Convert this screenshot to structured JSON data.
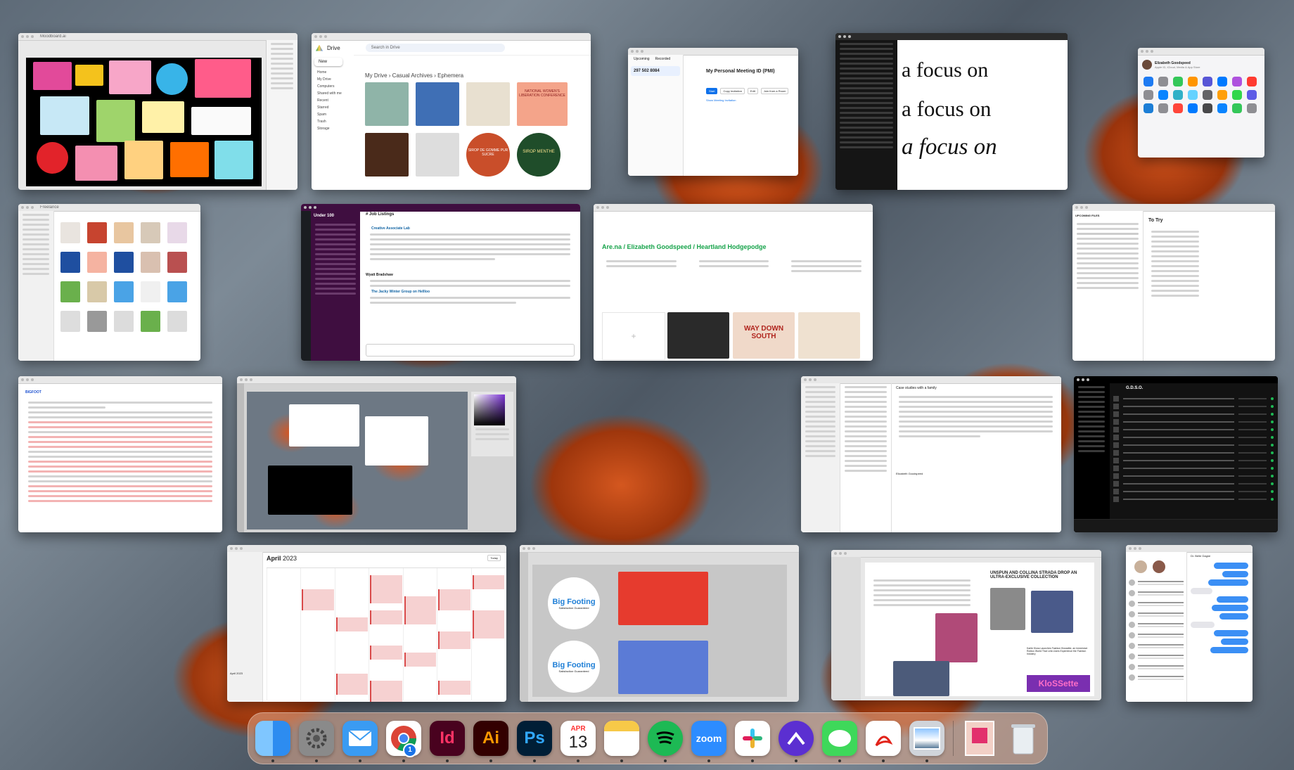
{
  "windows": {
    "illustrator_moodboard": {
      "title": "Moodboard.ai"
    },
    "drive": {
      "app": "Drive",
      "search_placeholder": "Search in Drive",
      "breadcrumb": [
        "My Drive",
        "Casual Archives",
        "Ephemera"
      ],
      "new_label": "New",
      "sidebar": [
        "Home",
        "My Drive",
        "Computers",
        "Shared with me",
        "Recent",
        "Starred",
        "Spam",
        "Trash",
        "Storage"
      ],
      "card_texts": [
        "NATIONAL WOMEN'S LIBERATION CONFERENCE",
        "SIROP DE GOMME PUR SUCRE",
        "SIROP MENTHE"
      ]
    },
    "zoom": {
      "tabs": [
        "Upcoming",
        "Recorded"
      ],
      "meeting_id": "297 502 8084",
      "meeting_title": "My Personal Meeting ID (PMI)",
      "buttons": [
        "Start",
        "Copy Invitation",
        "Edit",
        "Join from a Room"
      ],
      "link": "Show Meeting Invitation"
    },
    "type_preview": {
      "lines": [
        "a focus on",
        "a focus on",
        "a focus on"
      ]
    },
    "system_settings": {
      "user": "Elizabeth Goodspeed",
      "subtitle": "Apple ID, iCloud, Media & App Store"
    },
    "finder": {
      "title": "Freelance"
    },
    "slack": {
      "workspace": "Under 100",
      "channel": "# Job Listings",
      "post_title": "Creative Associate Lab",
      "post_title2": "The Jacky Winter Group on Hellloo",
      "post_author": "Wyatt Bradshaw"
    },
    "arena": {
      "breadcrumb": "Are.na / Elizabeth Goodspeed / Heartland Hodgepodge",
      "sticker1": "WAY DOWN SOUTH"
    },
    "notes": {
      "title": "To Try",
      "heading": "UPCOMING FILES"
    },
    "text_doc": {
      "title": "BIGFOOT"
    },
    "photoshop": {},
    "mail": {
      "title": "Case studies with a family",
      "from": "Elizabeth Goodspeed"
    },
    "spotify": {
      "playlist": "G.D.S.O."
    },
    "calendar": {
      "month": "April",
      "year": "2023",
      "today_label": "Today",
      "mini_month": "April 2023"
    },
    "illustrator_bigfooting": {
      "sticker_text": "Big Footing",
      "sticker_sub": "Satisfaction Guaranteed"
    },
    "indesign_layout": {
      "headline": "UNSPUN AND COLLINA STRADA DROP AN ULTRA-EXCLUSIVE COLLECTION",
      "article2": "Karlie Kloss Launches Fashion Klossette, an Immersive Roblox World That Lets Users Experience the Fashion Industry",
      "brand": "KloSSette"
    },
    "messages": {
      "contact": "Dr. Belle Gagne"
    }
  },
  "dock": {
    "apps": [
      {
        "name": "Finder",
        "icon": "finder-icon",
        "color": "#2d8cf0",
        "running": true
      },
      {
        "name": "System Settings",
        "icon": "gear-icon",
        "color": "#8a8a8a",
        "running": true
      },
      {
        "name": "Mail",
        "icon": "mail-icon",
        "color": "#3a9bf2",
        "running": true
      },
      {
        "name": "Chrome",
        "icon": "chrome-icon",
        "color": "#ffffff",
        "badge": "1",
        "running": true
      },
      {
        "name": "InDesign",
        "label": "Id",
        "icon": "indesign-icon",
        "color": "#49021f",
        "fg": "#ff3366",
        "running": true
      },
      {
        "name": "Illustrator",
        "label": "Ai",
        "icon": "illustrator-icon",
        "color": "#330000",
        "fg": "#ff9a00",
        "running": true
      },
      {
        "name": "Photoshop",
        "label": "Ps",
        "icon": "photoshop-icon",
        "color": "#001e36",
        "fg": "#31a8ff",
        "running": true
      },
      {
        "name": "Calendar",
        "month": "APR",
        "day": "13",
        "icon": "calendar-icon",
        "color": "#ffffff",
        "running": true
      },
      {
        "name": "Notes",
        "icon": "notes-icon",
        "color": "#ffffff",
        "running": true
      },
      {
        "name": "Spotify",
        "icon": "spotify-icon",
        "color": "#1db954",
        "running": true
      },
      {
        "name": "Zoom",
        "label": "zoom",
        "icon": "zoom-icon",
        "color": "#2d8cff",
        "running": true
      },
      {
        "name": "Slack",
        "icon": "slack-icon",
        "color": "#ffffff",
        "running": true
      },
      {
        "name": "Are.na",
        "icon": "arena-icon",
        "color": "#5b2fd1",
        "running": true
      },
      {
        "name": "Messages",
        "icon": "messages-icon",
        "color": "#3ed85a",
        "running": true
      },
      {
        "name": "Acrobat",
        "icon": "acrobat-icon",
        "color": "#ffffff",
        "running": true
      },
      {
        "name": "Preview",
        "icon": "preview-icon",
        "color": "#d0d4da",
        "running": true
      }
    ],
    "recent": [
      {
        "name": "Downloads",
        "icon": "downloads-stack-icon"
      },
      {
        "name": "Trash",
        "icon": "trash-icon"
      }
    ]
  }
}
